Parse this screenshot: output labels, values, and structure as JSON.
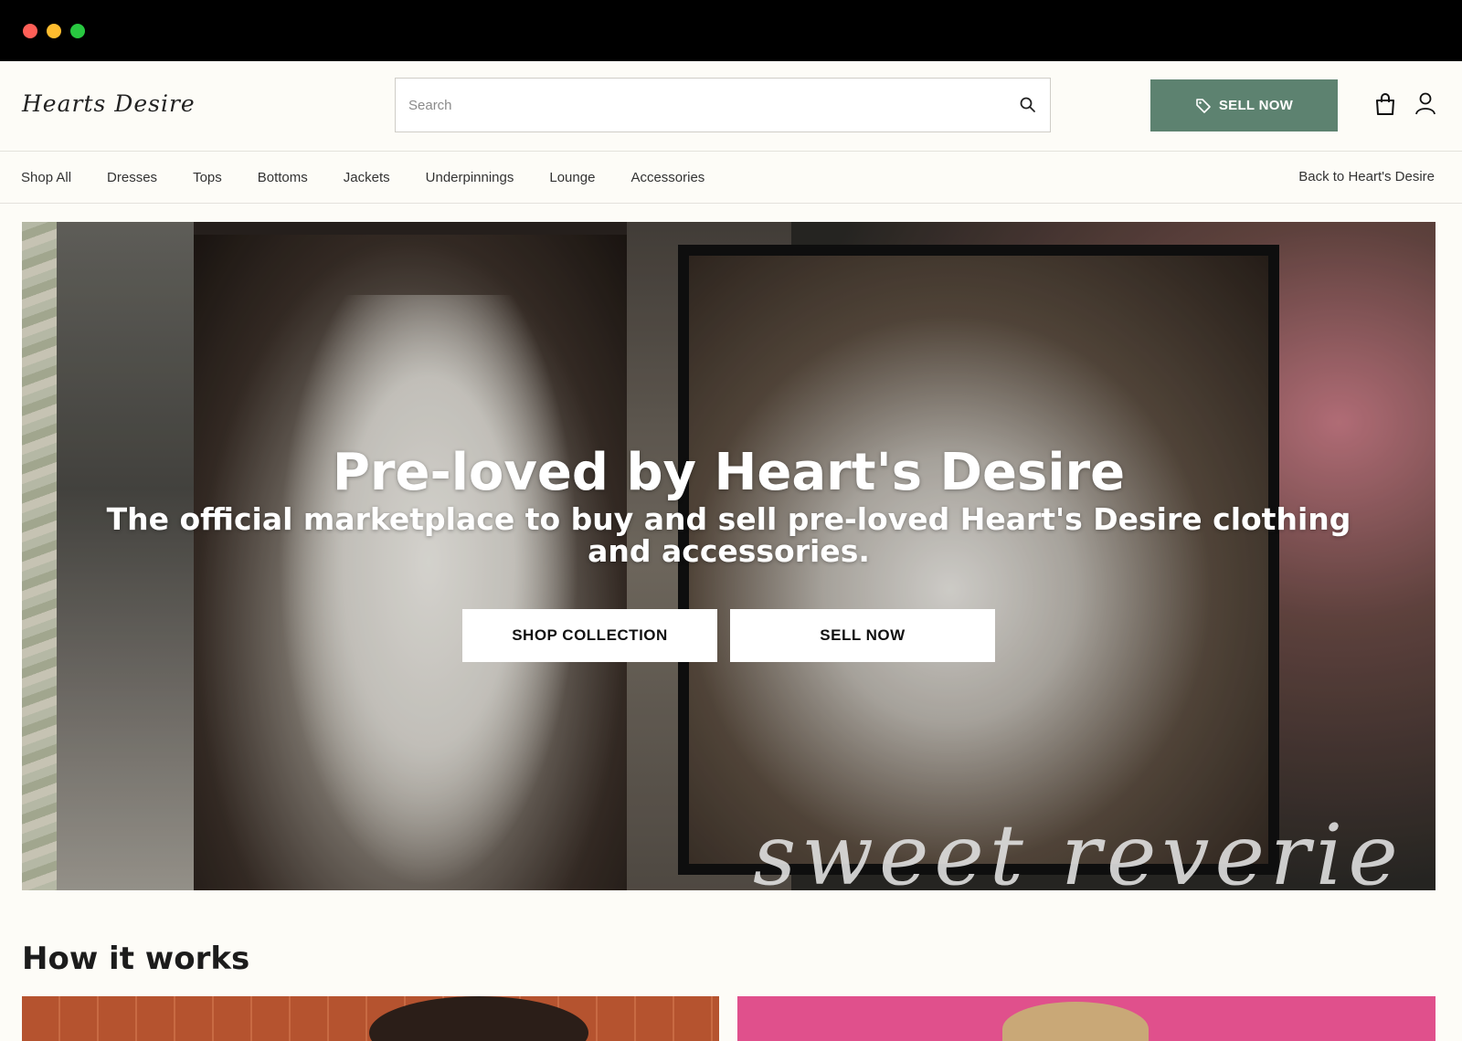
{
  "brand": {
    "name": "Hearts Desire"
  },
  "search": {
    "placeholder": "Search"
  },
  "header": {
    "sell_label": "SELL NOW"
  },
  "nav": {
    "items": [
      "Shop All",
      "Dresses",
      "Tops",
      "Bottoms",
      "Jackets",
      "Underpinnings",
      "Lounge",
      "Accessories"
    ],
    "back_label": "Back to Heart's Desire"
  },
  "hero": {
    "title": "Pre-loved by Heart's Desire",
    "subtitle": "The official marketplace to buy and sell pre-loved Heart's Desire clothing and accessories.",
    "shop_button": "SHOP COLLECTION",
    "sell_button": "SELL NOW",
    "script_text": "sweet reverie"
  },
  "how": {
    "title": "How it works"
  },
  "colors": {
    "accent": "#5d8270",
    "background": "#fdfcf7"
  }
}
